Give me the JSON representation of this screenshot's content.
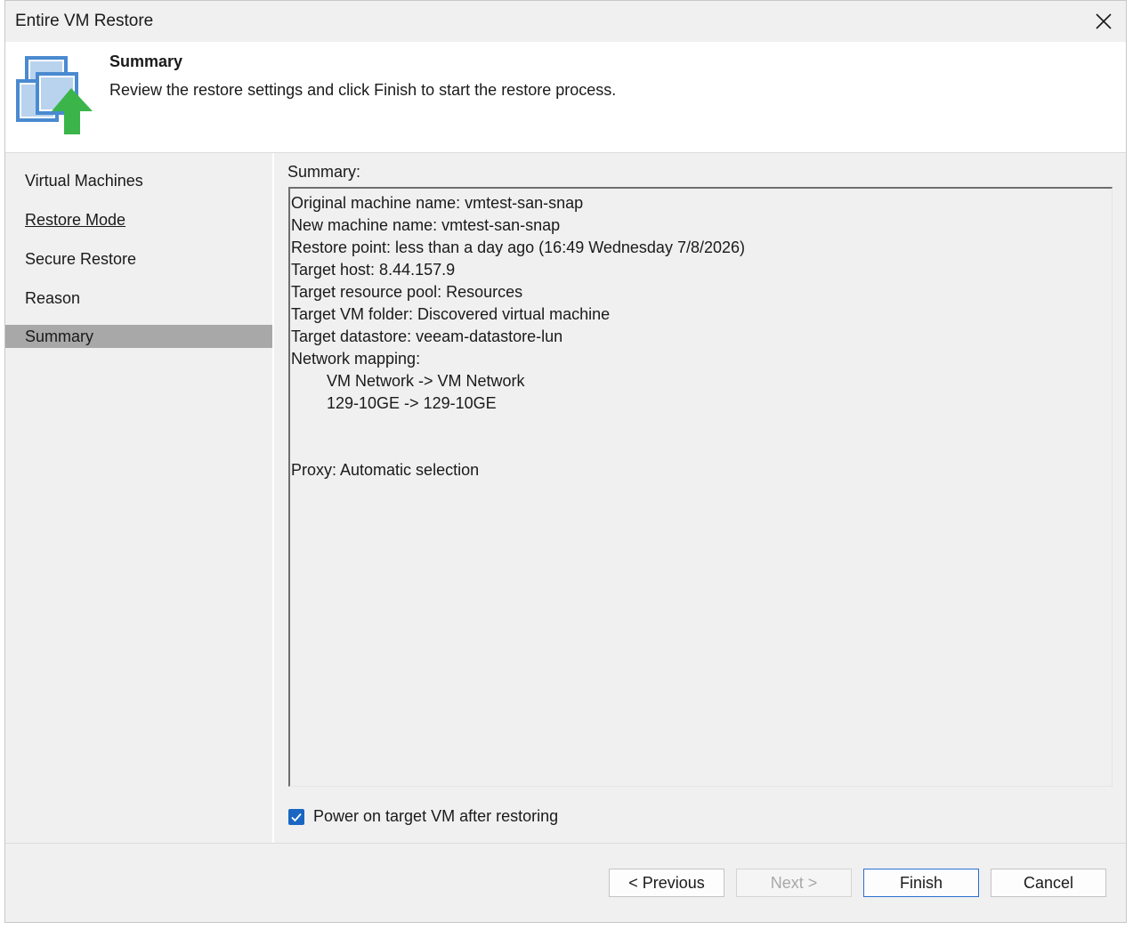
{
  "window": {
    "title": "Entire VM Restore"
  },
  "header": {
    "title": "Summary",
    "subtitle": "Review the restore settings and click Finish to start the restore process."
  },
  "nav": {
    "items": [
      {
        "label": "Virtual Machines"
      },
      {
        "label": "Restore Mode"
      },
      {
        "label": "Secure Restore"
      },
      {
        "label": "Reason"
      },
      {
        "label": "Summary"
      }
    ],
    "selected": "Summary"
  },
  "summary": {
    "label": "Summary:",
    "lines": {
      "original_name": "Original machine name: vmtest-san-snap",
      "new_name": "New machine name: vmtest-san-snap",
      "restore_point": "Restore point: less than a day ago (16:49 Wednesday 7/8/2026)",
      "target_host": "Target host: 8.44.157.9",
      "resource_pool": "Target resource pool: Resources",
      "vm_folder": "Target VM folder: Discovered virtual machine",
      "datastore": "Target datastore: veeam-datastore-lun",
      "network_mapping": "Network mapping:",
      "network_1": "VM Network -> VM Network",
      "network_2": "129-10GE -> 129-10GE",
      "proxy": "Proxy: Automatic selection"
    }
  },
  "options": {
    "power_on_label": "Power on target VM after restoring",
    "power_on_checked": true
  },
  "buttons": {
    "previous": "< Previous",
    "next": "Next >",
    "finish": "Finish",
    "cancel": "Cancel"
  },
  "icons": {
    "header": "vm-restore-icon",
    "close": "close-icon",
    "check": "checkmark-icon"
  },
  "colors": {
    "accent": "#1a66c2",
    "selected_nav": "#a8a8a8",
    "arrow_green": "#3bb54a",
    "vm_blue": "#4a8ad0"
  }
}
